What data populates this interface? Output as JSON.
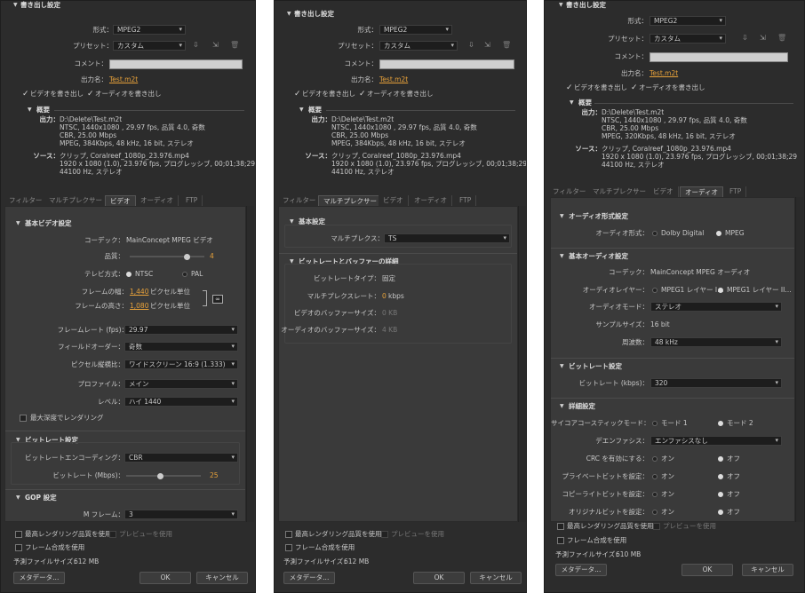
{
  "export": {
    "title": "書き出し設定",
    "format_label": "形式：",
    "format": "MPEG2",
    "preset_label": "プリセット：",
    "preset": "カスタム",
    "comment_label": "コメント：",
    "output_label": "出力名：",
    "output": "Test.m2t",
    "export_video": "ビデオを書き出し",
    "export_audio": "オーディオを書き出し"
  },
  "summary": {
    "title": "概要",
    "output_label": "出力：",
    "source_label": "ソース：",
    "p1": {
      "out": [
        "D:\\Delete\\Test.m2t",
        "NTSC, 1440x1080 , 29.97 fps, 品質 4.0, 奇数",
        "CBR, 25.00 Mbps",
        "MPEG, 384Kbps, 48 kHz, 16 bit, ステレオ"
      ],
      "src": [
        "クリップ, Coralreef_1080p_23.976.mp4",
        "1920 x 1080 (1.0), 23.976 fps, プログレッシブ, 00;01;38;29",
        "44100 Hz, ステレオ"
      ]
    },
    "p2": {
      "out": [
        "D:\\Delete\\Test.m2t",
        "NTSC, 1440x1080 , 29.97 fps, 品質 4.0, 奇数",
        "CBR, 25.00 Mbps",
        "MPEG, 384Kbps, 48 kHz, 16 bit, ステレオ"
      ],
      "src": [
        "クリップ, Coralreef_1080p_23.976.mp4",
        "1920 x 1080 (1.0), 23.976 fps, プログレッシブ, 00;01;38;29",
        "44100 Hz, ステレオ"
      ]
    },
    "p3": {
      "out": [
        "D:\\Delete\\Test.m2t",
        "NTSC, 1440x1080 , 29.97 fps, 品質 4.0, 奇数",
        "CBR, 25.00 Mbps",
        "MPEG, 320Kbps, 48 kHz, 16 bit, ステレオ"
      ],
      "src": [
        "クリップ, Coralreef_1080p_23.976.mp4",
        "1920 x 1080 (1.0), 23.976 fps, プログレッシブ, 00;01;38;29",
        "44100 Hz, ステレオ"
      ]
    }
  },
  "tabs": [
    "フィルター",
    "マルチプレクサー",
    "ビデオ",
    "オーディオ",
    "FTP"
  ],
  "video": {
    "basic_title": "基本ビデオ設定",
    "codec_label": "コーデック：",
    "codec": "MainConcept MPEG ビデオ",
    "quality_label": "品質：",
    "quality": "4",
    "quality_fraction": 0.8,
    "tv_label": "テレビ方式：",
    "ntsc": "NTSC",
    "pal": "PAL",
    "width_label": "フレームの幅：",
    "width": "1,440",
    "height_label": "フレームの高さ：",
    "height": "1,080",
    "pixel_unit": "ピクセル単位",
    "fps_label": "フレームレート (fps)：",
    "fps": "29.97",
    "field_label": "フィールドオーダー：",
    "field": "奇数",
    "aspect_label": "ピクセル縦横比：",
    "aspect": "ワイドスクリーン 16:9 (1.333)",
    "profile_label": "プロファイル：",
    "profile": "メイン",
    "level_label": "レベル：",
    "level": "ハイ 1440",
    "max_depth": "最大深度でレンダリング",
    "bitrate_title": "ビットレート設定",
    "encoding_label": "ビットレートエンコーディング：",
    "encoding": "CBR",
    "bitrate_label": "ビットレート (Mbps)：",
    "bitrate": "25",
    "bitrate_fraction": 0.45,
    "gop_title": "GOP 設定",
    "m_label": "M フレーム：",
    "m": "3"
  },
  "mux": {
    "basic_title": "基本設定",
    "multiplex_label": "マルチプレクス：",
    "multiplex": "TS",
    "buffer_title": "ビットレートとバッファーの詳細",
    "type_label": "ビットレートタイプ：",
    "type": "固定",
    "rate_label": "マルチプレクスレート：",
    "rate": "0",
    "rate_unit": "kbps",
    "vbuf_label": "ビデオのバッファーサイズ：",
    "vbuf": "0 KB",
    "abuf_label": "オーディオのバッファーサイズ：",
    "abuf": "4 KB"
  },
  "audio": {
    "format_title": "オーディオ形式設定",
    "format_label": "オーディオ形式：",
    "dolby": "Dolby Digital",
    "mpeg": "MPEG",
    "basic_title": "基本オーディオ設定",
    "codec_label": "コーデック：",
    "codec": "MainConcept MPEG オーディオ",
    "layer_label": "オーディオレイヤー：",
    "layer1": "MPEG1 レイヤー I…",
    "layer2": "MPEG1 レイヤー II…",
    "mode_label": "オーディオモード：",
    "mode": "ステレオ",
    "sample_label": "サンプルサイズ：",
    "sample": "16 bit",
    "freq_label": "周波数：",
    "freq": "48 kHz",
    "bitrate_title": "ビットレート設定",
    "bitrate_label": "ビットレート (kbps)：",
    "bitrate": "320",
    "detail_title": "詳細設定",
    "psy_label": "サイコアコースティックモード：",
    "mode1": "モード 1",
    "mode2": "モード 2",
    "emph_label": "デエンファシス：",
    "emph": "エンファシスなし",
    "crc_label": "CRC を有効にする：",
    "priv_label": "プライベートビットを設定：",
    "copy_label": "コピーライトビットを設定：",
    "orig_label": "オリジナルビットを設定：",
    "on": "オン",
    "off": "オフ"
  },
  "footer": {
    "max_quality": "最高レンダリング品質を使用",
    "preview": "プレビューを使用",
    "frame_blend": "フレーム合成を使用",
    "est_label": "予測ファイルサイズ：",
    "est_p1": "612 MB",
    "est_p2": "612 MB",
    "est_p3": "610 MB",
    "metadata": "メタデータ...",
    "ok": "OK",
    "cancel": "キャンセル"
  }
}
